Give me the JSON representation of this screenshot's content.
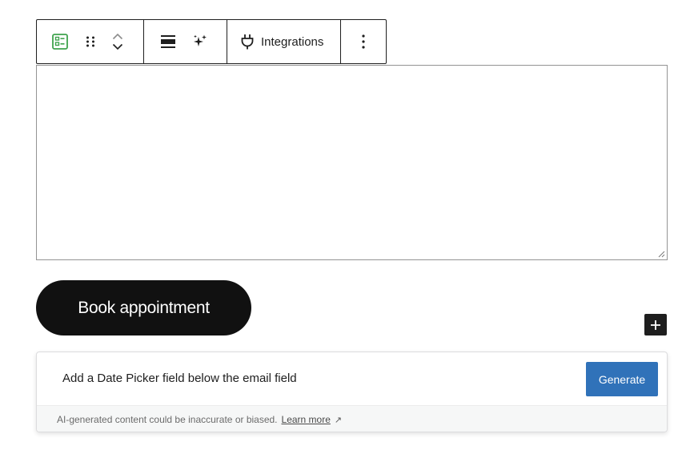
{
  "toolbar": {
    "integrations_label": "Integrations",
    "icons": [
      "form-icon",
      "drag-handle-icon",
      "chevron-up-icon",
      "chevron-down-icon",
      "align-icon",
      "sparkle-icon",
      "plug-icon",
      "more-vertical-icon"
    ],
    "accent_color": "#3fa34d"
  },
  "textarea": {
    "value": ""
  },
  "book_button": {
    "label": "Book appointment"
  },
  "inserter": {
    "icon": "plus-icon"
  },
  "ai_panel": {
    "prompt": "Add a Date Picker field below the email field",
    "generate_label": "Generate",
    "disclaimer": "AI-generated content could be inaccurate or biased.",
    "learn_more": "Learn more",
    "ext_icon": "↗",
    "generate_color": "#3072b9"
  }
}
